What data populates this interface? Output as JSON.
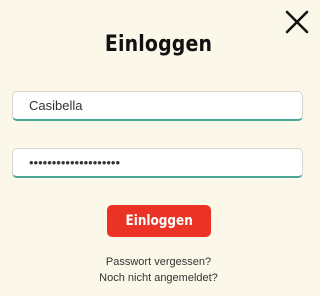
{
  "dialog": {
    "title": "Einloggen",
    "close_icon": "close-icon"
  },
  "form": {
    "username_value": "Casibella",
    "password_value": "••••••••••••••••••••",
    "submit_label": "Einloggen"
  },
  "links": {
    "forgot_password": "Passwort vergessen?",
    "not_registered": "Noch nicht angemeldet?"
  },
  "colors": {
    "background": "#fbf8ea",
    "accent_red": "#ea3325",
    "field_underline": "#4aa695"
  }
}
